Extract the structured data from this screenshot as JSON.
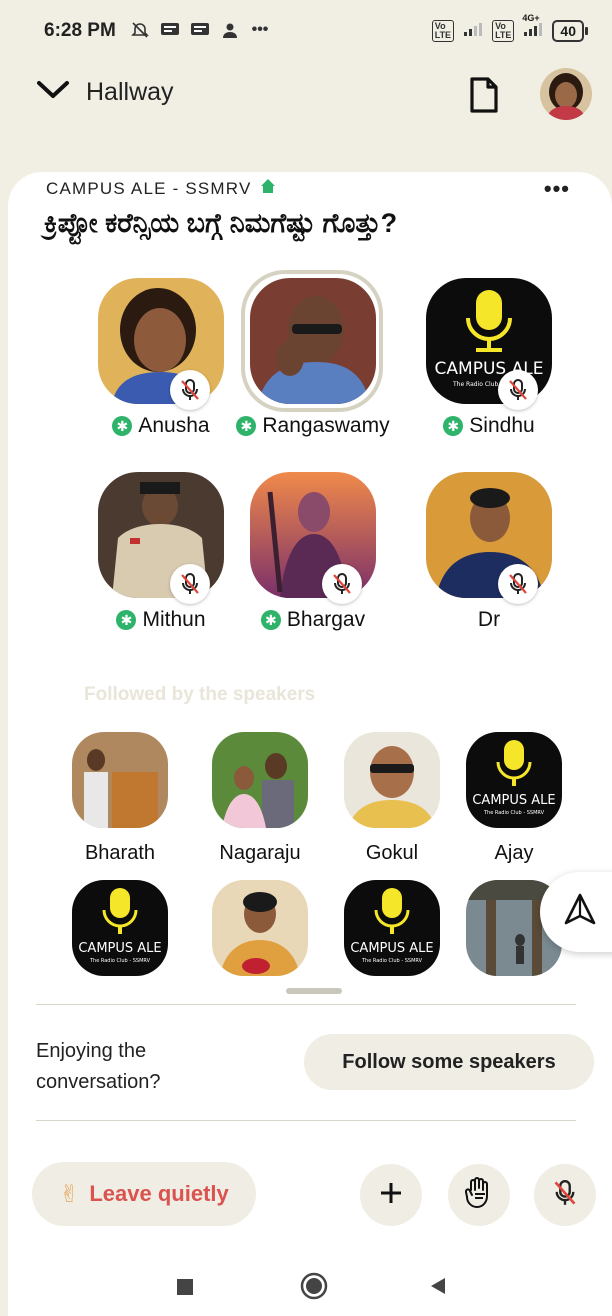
{
  "status_bar": {
    "time": "6:28 PM",
    "network_label": "4G+",
    "battery": "40"
  },
  "header": {
    "room_location": "Hallway"
  },
  "room": {
    "club_name": "CAMPUS ALE - SSMRV",
    "more_label": "•••",
    "title": "ಕ್ರಿಪ್ಟೋ ಕರೆನ್ಸಿಯ ಬಗ್ಗೆ ನಿಮಗೆಷ್ಟು ಗೊತ್ತು?"
  },
  "speakers": [
    {
      "name": "Anusha",
      "moderator": true,
      "muted": true
    },
    {
      "name": "Rangaswamy",
      "moderator": true,
      "muted": false,
      "speaking": true
    },
    {
      "name": "Sindhu",
      "moderator": true,
      "muted": true
    },
    {
      "name": "Mithun",
      "moderator": true,
      "muted": true
    },
    {
      "name": "Bhargav",
      "moderator": true,
      "muted": true
    },
    {
      "name": "Dr",
      "moderator": false,
      "muted": true
    }
  ],
  "mod_badge_glyph": "✱",
  "followed_section_label": "Followed by the speakers",
  "listeners": [
    {
      "name": "Bharath"
    },
    {
      "name": "Nagaraju"
    },
    {
      "name": "Gokul"
    },
    {
      "name": "Ajay"
    }
  ],
  "logo": {
    "line1": "CAMPUS ALE",
    "line2": "The Radio Club - SSMRV"
  },
  "footer": {
    "enjoy_text": "Enjoying the conversation?",
    "follow_button": "Follow some speakers",
    "leave_emoji": "✌",
    "leave_button": "Leave quietly"
  },
  "colors": {
    "background": "#f1efe4",
    "moderator_green": "#2db36a",
    "leave_red": "#d9534f",
    "mic_yellow": "#f5e62a"
  }
}
